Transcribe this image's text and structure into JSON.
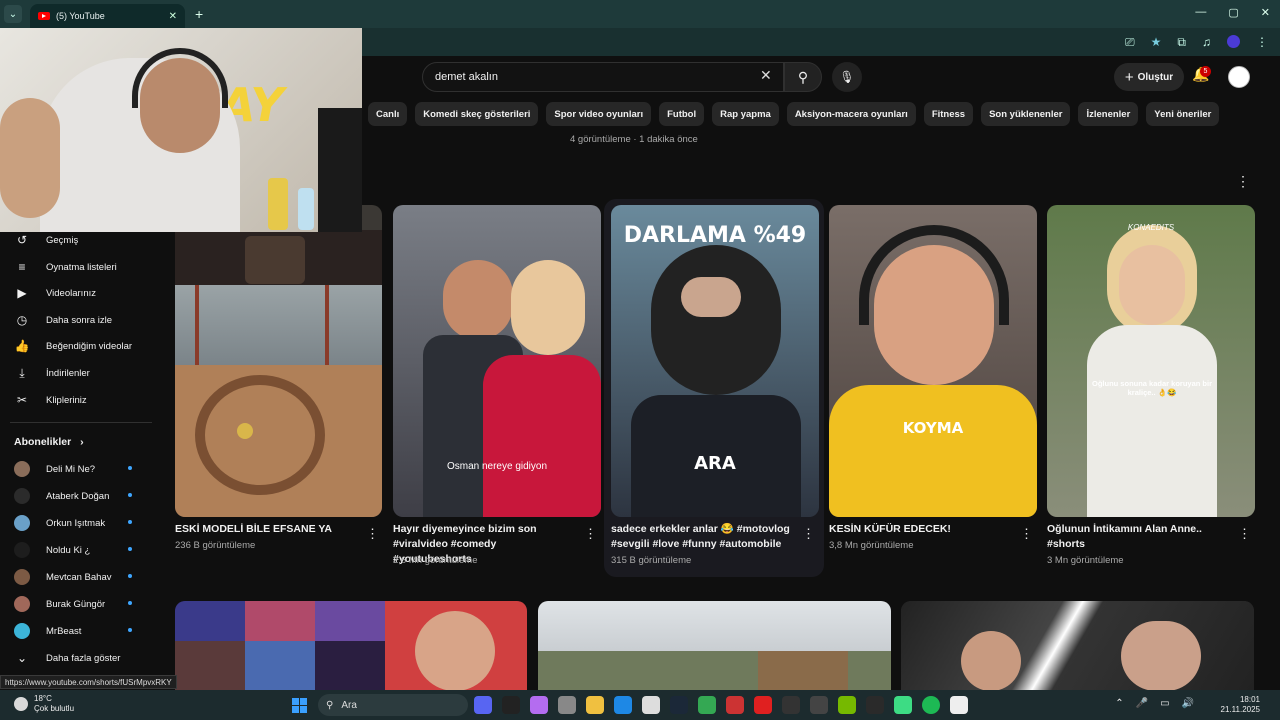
{
  "browser": {
    "tab_title": "(5) YouTube",
    "tab_close": "✕",
    "new_tab": "+",
    "window": {
      "minimize": "—",
      "maximize": "▢",
      "close": "✕"
    }
  },
  "header": {
    "search_value": "demet akalın",
    "create_label": "Oluştur",
    "notification_count": "5"
  },
  "chips": [
    "Canlı",
    "Komedi skeç gösterileri",
    "Spor video oyunları",
    "Futbol",
    "Rap yapma",
    "Aksiyon-macera oyunları",
    "Fitness",
    "Son yüklenenler",
    "İzlenenler",
    "Yeni öneriler"
  ],
  "meta_line": "4 görüntüleme · 1 dakika önce",
  "sidebar": {
    "items": [
      {
        "label": "Geçmiş",
        "icon": "history-icon",
        "glyph": "↺"
      },
      {
        "label": "Oynatma listeleri",
        "icon": "playlist-icon",
        "glyph": "≡"
      },
      {
        "label": "Videolarınız",
        "icon": "your-videos-icon",
        "glyph": "▶"
      },
      {
        "label": "Daha sonra izle",
        "icon": "watch-later-icon",
        "glyph": "◷"
      },
      {
        "label": "Beğendiğim videolar",
        "icon": "thumbs-up-icon",
        "glyph": "👍"
      },
      {
        "label": "İndirilenler",
        "icon": "download-icon",
        "glyph": "⤓"
      },
      {
        "label": "Klipleriniz",
        "icon": "clips-icon",
        "glyph": "✂"
      }
    ],
    "subs_heading": "Abonelikler",
    "subs_chevron": "›",
    "subscriptions": [
      {
        "label": "Deli Mi Ne?",
        "color": "#8a6d5a"
      },
      {
        "label": "Ataberk Doğan",
        "color": "#2b2b2b"
      },
      {
        "label": "Orkun Işıtmak",
        "color": "#6aa0c8"
      },
      {
        "label": "Noldu Ki ¿",
        "color": "#1d1d1d"
      },
      {
        "label": "Mevtcan Bahav",
        "color": "#7c5a44"
      },
      {
        "label": "Burak Güngör",
        "color": "#a0685a"
      },
      {
        "label": "MrBeast",
        "color": "#3cb4d8"
      }
    ],
    "show_more": "Daha fazla göster"
  },
  "shorts": [
    {
      "title": "ESKİ MODELİ BİLE EFSANE YA",
      "views": "236 B görüntüleme",
      "overlay": ""
    },
    {
      "title": "Hayır diyemeyince bizim son #viralvideo #comedy #youtubeshorts",
      "views": "2,6 Mn görüntüleme",
      "overlay": "Osman nereye gidiyon"
    },
    {
      "title": "sadece erkekler anlar 😂 #motovlog #sevgili #love #funny #automobile",
      "views": "315 B görüntüleme",
      "overlay": "DARLAMA %49",
      "overlay2": "ARA"
    },
    {
      "title": "KESİN KÜFÜR EDECEK!",
      "views": "3,8 Mn görüntüleme",
      "overlay": "KOYMA"
    },
    {
      "title": "Oğlunun İntikamını Alan Anne.. #shorts",
      "views": "3 Mn görüntüleme",
      "overlay": "Oğlunu sonuna kadar koruyan bir kraliçe.. 👌😂",
      "watermark": "KONAEDITS"
    }
  ],
  "status_url": "https://www.youtube.com/shorts/fUSrMpvxRKY",
  "taskbar": {
    "temp": "18°C",
    "weather": "Çok bulutlu",
    "search": "Ara",
    "time": "18:01",
    "date": "21.11.2025"
  },
  "colors": {
    "accent": "#ff0000",
    "bg": "#0f0f0f",
    "link": "#3ea6ff"
  }
}
